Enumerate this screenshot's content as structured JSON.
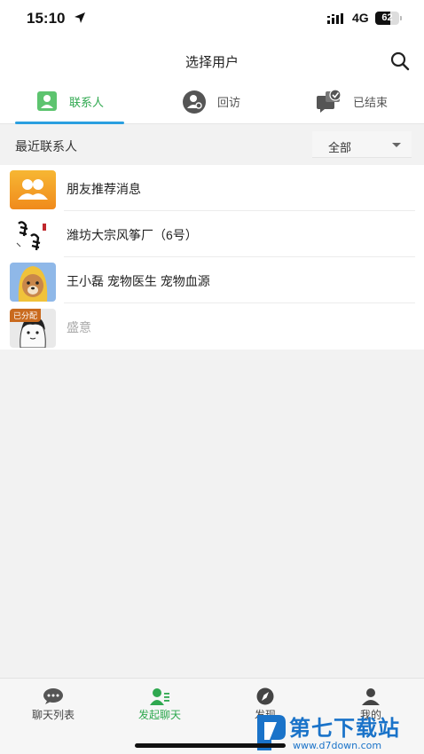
{
  "status_bar": {
    "time": "15:10",
    "network": "4G",
    "battery": "62",
    "battery_level": 0.62
  },
  "header": {
    "title": "选择用户"
  },
  "tabs": [
    {
      "label": "联系人",
      "icon": "contact-card-icon",
      "active": true
    },
    {
      "label": "回访",
      "icon": "return-visit-icon",
      "active": false
    },
    {
      "label": "已结束",
      "icon": "finished-chat-icon",
      "active": false
    }
  ],
  "filter": {
    "title": "最近联系人",
    "selected": "全部"
  },
  "contacts": [
    {
      "name": "朋友推荐消息",
      "avatar": "group-avatar-icon"
    },
    {
      "name": "潍坊大宗风筝厂（6号）",
      "avatar": "kite-calligraphy-avatar"
    },
    {
      "name": "王小磊 宠物医生 宠物血源",
      "avatar": "dog-photo-avatar"
    },
    {
      "name": "盛意",
      "avatar": "cartoon-avatar",
      "badge": "已分配"
    }
  ],
  "bottom_nav": [
    {
      "label": "聊天列表",
      "icon": "chat-bubble-icon",
      "active": false
    },
    {
      "label": "发起聊天",
      "icon": "start-chat-icon",
      "active": true
    },
    {
      "label": "发现",
      "icon": "compass-icon",
      "active": false
    },
    {
      "label": "我的",
      "icon": "person-icon",
      "active": false
    }
  ],
  "watermark": {
    "title": "第七下载站",
    "url": "www.d7down.com"
  },
  "colors": {
    "accent_green": "#2fa84f",
    "tab_underline": "#2a9fe0",
    "watermark_blue": "#1a73c9",
    "badge_orange": "#c96a1e"
  }
}
